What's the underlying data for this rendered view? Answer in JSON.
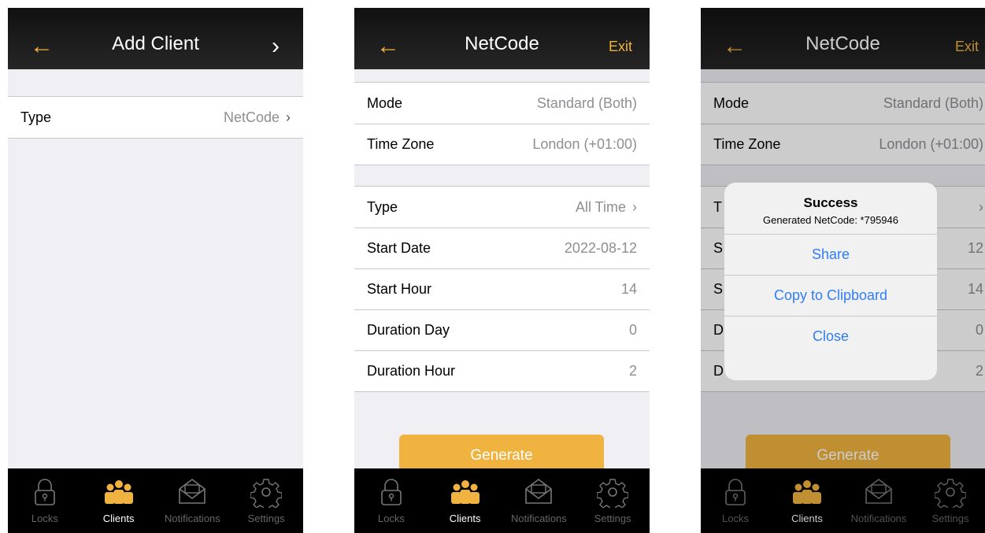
{
  "screen1": {
    "nav": {
      "title": "Add Client",
      "back": "←",
      "forward": "›"
    },
    "type_row": {
      "label": "Type",
      "value": "NetCode",
      "chevron": "›"
    }
  },
  "screen2": {
    "nav": {
      "title": "NetCode",
      "back": "←",
      "right": "Exit"
    },
    "group1": [
      {
        "label": "Mode",
        "value": "Standard (Both)"
      },
      {
        "label": "Time Zone",
        "value": "London (+01:00)"
      }
    ],
    "group2": [
      {
        "label": "Type",
        "value": "All Time",
        "chevron": "›"
      },
      {
        "label": "Start Date",
        "value": "2022-08-12"
      },
      {
        "label": "Start Hour",
        "value": "14"
      },
      {
        "label": "Duration Day",
        "value": "0"
      },
      {
        "label": "Duration Hour",
        "value": "2"
      }
    ],
    "generate": "Generate"
  },
  "screen3": {
    "nav": {
      "title": "NetCode",
      "back": "←",
      "right": "Exit"
    },
    "group1": [
      {
        "label": "Mode",
        "value": "Standard (Both)"
      },
      {
        "label": "Time Zone",
        "value": "London (+01:00)"
      }
    ],
    "group2_partial": [
      {
        "label": "T",
        "value": "›"
      },
      {
        "label": "S",
        "value": "12"
      },
      {
        "label": "S",
        "value": "14"
      },
      {
        "label": "D",
        "value": "0"
      },
      {
        "label": "D",
        "value": "2"
      }
    ],
    "generate": "Generate",
    "alert": {
      "title": "Success",
      "message": "Generated NetCode: *795946",
      "buttons": [
        "Share",
        "Copy to Clipboard",
        "Close"
      ]
    }
  },
  "tabs": [
    {
      "label": "Locks",
      "icon": "lock-icon"
    },
    {
      "label": "Clients",
      "icon": "clients-icon"
    },
    {
      "label": "Notifications",
      "icon": "envelope-icon"
    },
    {
      "label": "Settings",
      "icon": "gear-icon"
    }
  ],
  "colors": {
    "accent": "#f0b33f",
    "link": "#2f7ef5",
    "nav_bg": "#1a1a1a",
    "tab_bg": "#000000"
  }
}
